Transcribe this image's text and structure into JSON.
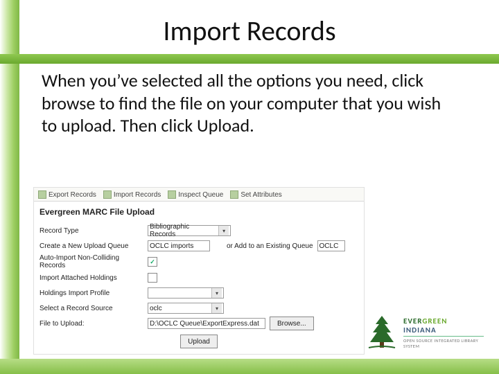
{
  "slide": {
    "title": "Import Records",
    "body": "When you’ve selected all the options you need, click browse to find the file on your computer that you wish to upload. Then click Upload."
  },
  "app": {
    "tabs": [
      "Export Records",
      "Import Records",
      "Inspect Queue",
      "Set Attributes"
    ],
    "heading": "Evergreen MARC File Upload",
    "form": {
      "record_type_label": "Record Type",
      "record_type_value": "Bibliographic Records",
      "new_queue_label": "Create a New Upload Queue",
      "new_queue_value": "OCLC imports",
      "existing_queue_label": "or Add to an Existing Queue",
      "existing_queue_value": "OCLC",
      "auto_import_label": "Auto-Import Non-Colliding Records",
      "auto_import_checked": true,
      "import_holdings_label": "Import Attached Holdings",
      "import_holdings_checked": false,
      "holdings_profile_label": "Holdings Import Profile",
      "holdings_profile_value": "",
      "record_source_label": "Select a Record Source",
      "record_source_value": "oclc",
      "file_label": "File to Upload:",
      "file_value": "D:\\OCLC Queue\\ExportExpress.dat",
      "browse_button": "Browse...",
      "upload_button": "Upload"
    }
  },
  "logo": {
    "line1a": "EVER",
    "line1b": "GREEN",
    "line1c": "INDIANA",
    "tagline": "OPEN SOURCE INTEGRATED LIBRARY SYSTEM"
  }
}
